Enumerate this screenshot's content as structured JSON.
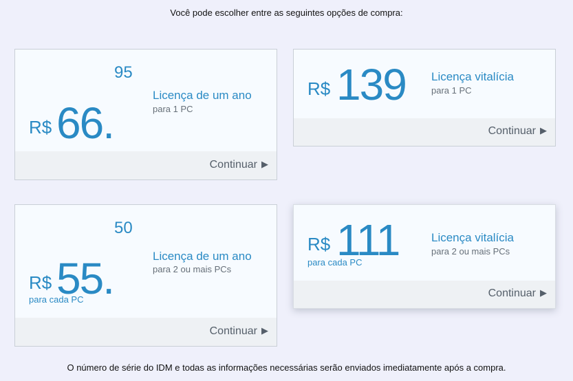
{
  "intro_text": "Você pode escolher entre as seguintes opções de compra:",
  "footer_text": "O número de série do IDM e todas as informações necessárias serão enviados imediatamente após a compra.",
  "colors": {
    "accent": "#2a8ac4",
    "background": "#eff0fb",
    "card": "#f7fbff",
    "bar": "#eef1f4"
  },
  "cards": [
    {
      "currency": "R$",
      "price": "66.",
      "cents": "95",
      "per": "",
      "title": "Licença de um ano",
      "subtitle": "para 1 PC",
      "continue_label": "Continuar",
      "arrow_icon": "▶"
    },
    {
      "currency": "R$",
      "price": "139",
      "cents": "",
      "per": "",
      "title": "Licença vitalícia",
      "subtitle": "para 1 PC",
      "continue_label": "Continuar",
      "arrow_icon": "▶"
    },
    {
      "currency": "R$",
      "price": "55.",
      "cents": "50",
      "per": "para cada PC",
      "title": "Licença de um ano",
      "subtitle": "para 2 ou mais PCs",
      "continue_label": "Continuar",
      "arrow_icon": "▶"
    },
    {
      "currency": "R$",
      "price": "111",
      "cents": "",
      "per": "para cada PC",
      "title": "Licença vitalícia",
      "subtitle": "para 2 ou mais PCs",
      "continue_label": "Continuar",
      "arrow_icon": "▶"
    }
  ]
}
